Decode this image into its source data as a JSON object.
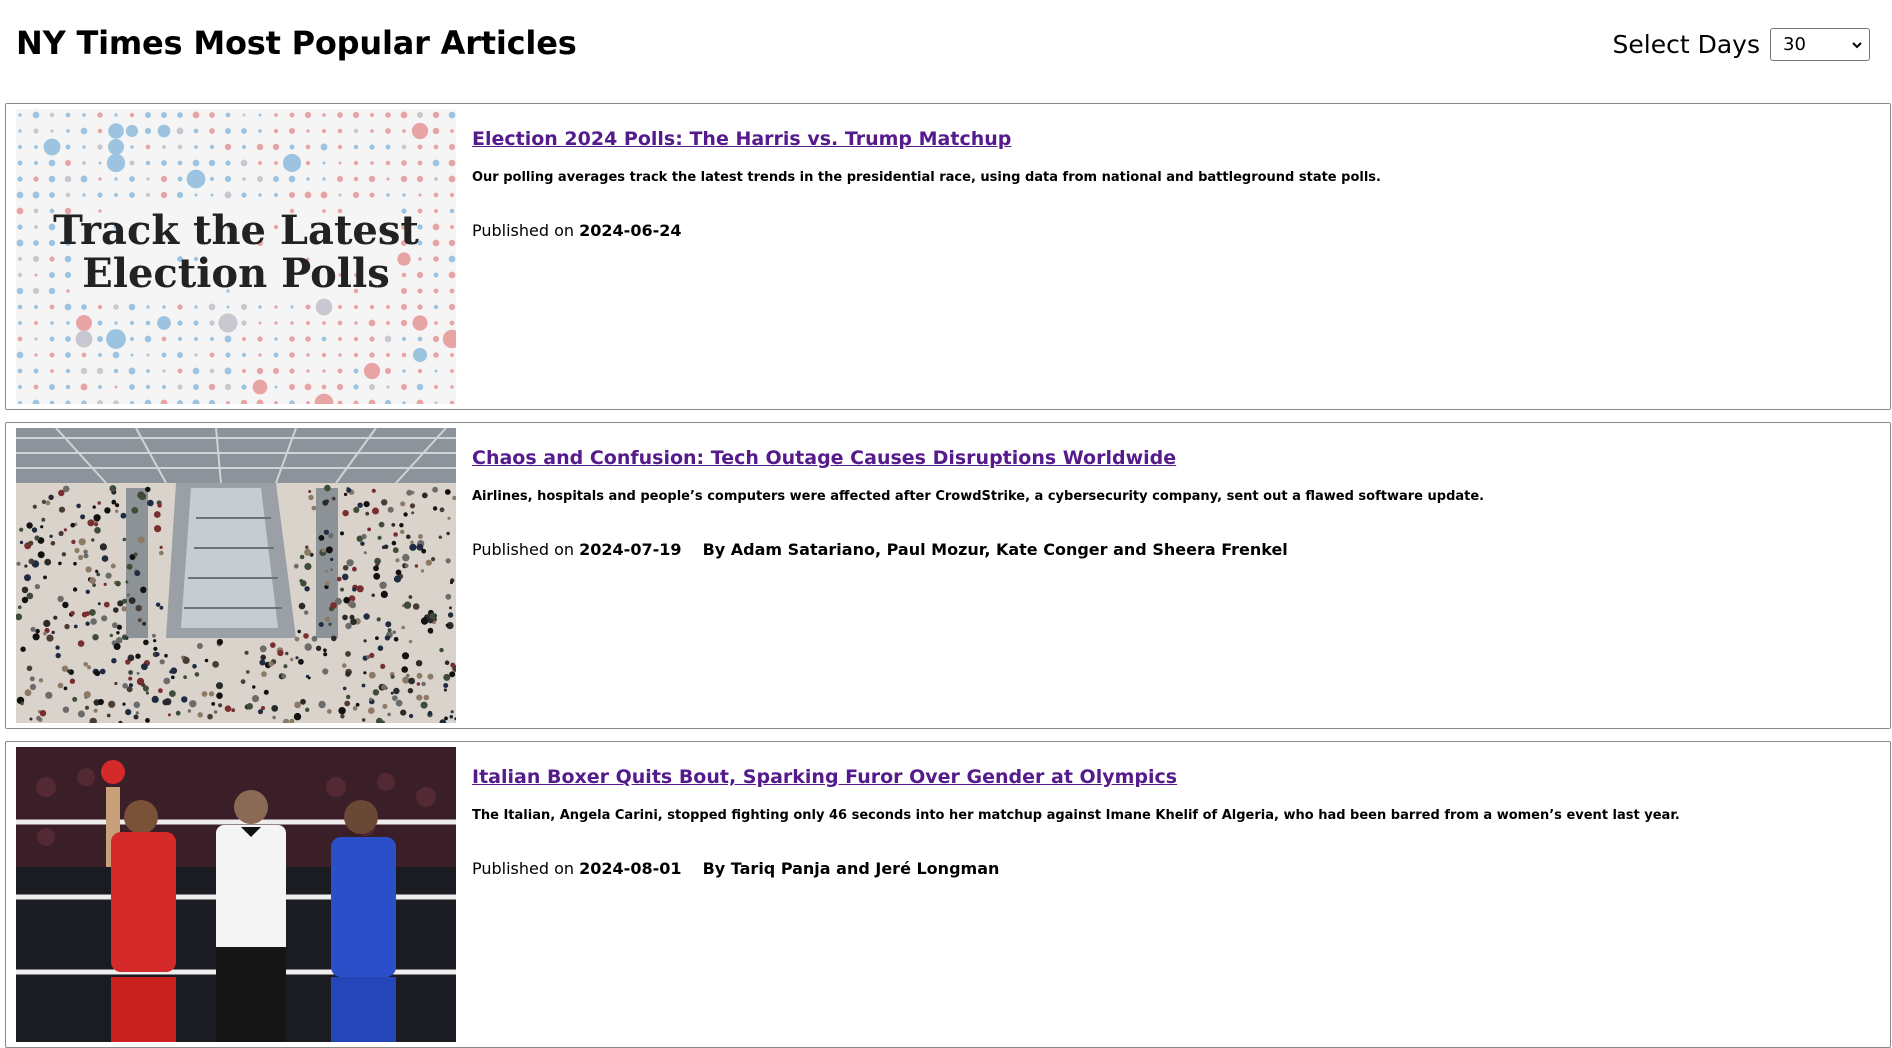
{
  "header": {
    "title": "NY Times Most Popular Articles",
    "days_label": "Select Days",
    "days_value": "30"
  },
  "articles": [
    {
      "title": "Election 2024 Polls: The Harris vs. Trump Matchup",
      "abstract": "Our polling averages track the latest trends in the presidential race, using data from national and battleground state polls.",
      "published_prefix": "Published on",
      "date": "2024-06-24",
      "byline": "",
      "image_text_line1": "Track the Latest",
      "image_text_line2": "Election Polls"
    },
    {
      "title": "Chaos and Confusion: Tech Outage Causes Disruptions Worldwide",
      "abstract": "Airlines, hospitals and people’s computers were affected after CrowdStrike, a cybersecurity company, sent out a flawed software update.",
      "published_prefix": "Published on",
      "date": "2024-07-19",
      "byline": "By Adam Satariano, Paul Mozur, Kate Conger and Sheera Frenkel"
    },
    {
      "title": "Italian Boxer Quits Bout, Sparking Furor Over Gender at Olympics",
      "abstract": "The Italian, Angela Carini, stopped fighting only 46 seconds into her matchup against Imane Khelif of Algeria, who had been barred from a women’s event last year.",
      "published_prefix": "Published on",
      "date": "2024-08-01",
      "byline": "By Tariq Panja and Jeré Longman"
    }
  ],
  "colors": {
    "link": "#551a8b",
    "poll_blue": "#9cc3e0",
    "poll_red": "#e8a3a3"
  }
}
